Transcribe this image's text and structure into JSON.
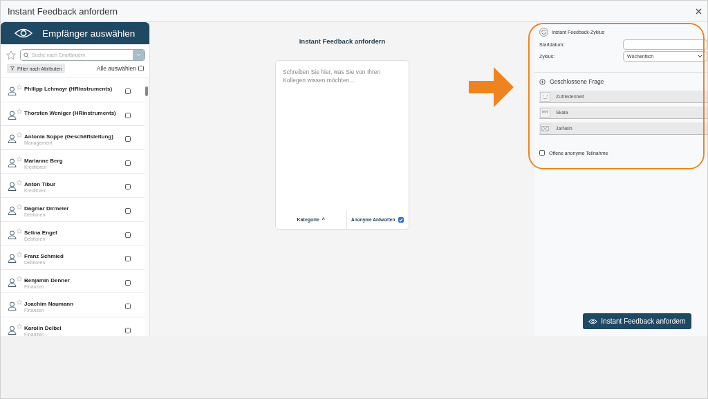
{
  "window": {
    "title": "Instant Feedback anfordern"
  },
  "recipients": {
    "title": "Empfänger auswählen",
    "search_placeholder": "Suche nach Empfängern",
    "filter_label": "Filter nach Attributen",
    "select_all": {
      "label": "Alle auswählen",
      "checked": false
    },
    "items": [
      {
        "name": "Philipp Lehmayr (HRinstruments)",
        "favorite": false,
        "checked": false
      },
      {
        "name": "Thorsten Weniger (HRinstruments)",
        "favorite": false,
        "checked": false
      },
      {
        "name": "Antonia Soppe (Geschäftsleitung)",
        "department": "Management",
        "favorite": false,
        "checked": false
      },
      {
        "name": "Marianne Berg",
        "department": "Kreditoren",
        "favorite": false,
        "checked": false
      },
      {
        "name": "Anton Tibur",
        "department": "Kreditoren",
        "favorite": false,
        "checked": false
      },
      {
        "name": "Dagmar Dirmeier",
        "department": "Debitoren",
        "favorite": false,
        "checked": false
      },
      {
        "name": "Selina Engel",
        "department": "Debitoren",
        "favorite": false,
        "checked": false
      },
      {
        "name": "Franz Schmied",
        "department": "Debitoren",
        "favorite": false,
        "checked": false
      },
      {
        "name": "Benjamin Denner",
        "department": "Finanzen",
        "favorite": false,
        "checked": false
      },
      {
        "name": "Joachim Naumann",
        "department": "Finanzen",
        "favorite": false,
        "checked": false
      },
      {
        "name": "Karolin Deibel",
        "department": "Finanzen",
        "favorite": false,
        "checked": false
      }
    ]
  },
  "compose": {
    "title": "Instant Feedback anfordern",
    "placeholder": "Schreiben Sie hier, was Sie von Ihren Kollegen wissen möchten...",
    "category_label": "Kategorie",
    "category_caret": "^",
    "anonymous": {
      "label": "Anonyme Antworten",
      "checked": true
    }
  },
  "cycle": {
    "title": "Instant Feedback-Zyklus",
    "start_label": "Startdatum:",
    "cycle_label": "Zyklus:",
    "cycle_value": "Wöchentlich",
    "closed_question": "Geschlossene Frage",
    "options": [
      {
        "kind": "smiley",
        "label": "Zufriedenheit"
      },
      {
        "kind": "scale",
        "label": "Skala"
      },
      {
        "kind": "yesno",
        "label": "Ja/Nein"
      }
    ],
    "open_anonymous": {
      "label": "Offene anonyme Teilnahme",
      "checked": false
    }
  },
  "submit": "Instant Feedback anfordern"
}
